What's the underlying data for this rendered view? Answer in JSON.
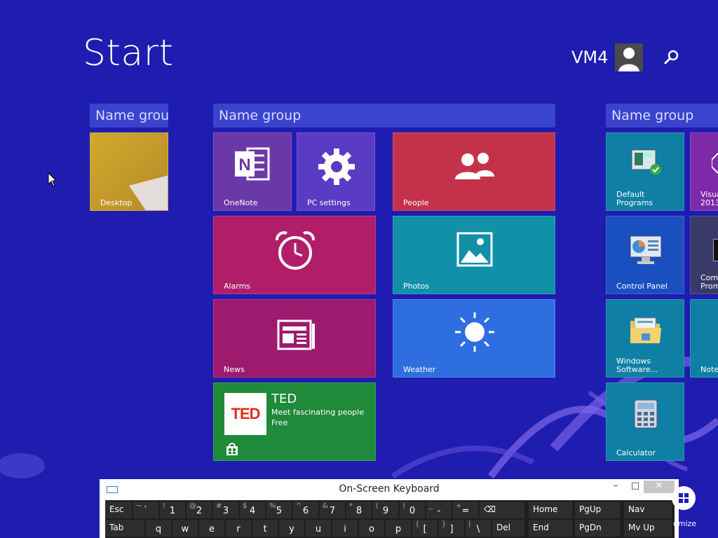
{
  "page": {
    "title": "Start",
    "bg_color": "#1f1cb0"
  },
  "user": {
    "name": "VM4"
  },
  "groups": [
    {
      "label": "Name grou"
    },
    {
      "label": "Name group"
    },
    {
      "label": "Name group"
    }
  ],
  "tiles": {
    "desktop": {
      "label": "Desktop",
      "color": "#c8a431"
    },
    "onenote": {
      "label": "OneNote",
      "color": "#6b38a8",
      "icon": "onenote-icon"
    },
    "pc_settings": {
      "label": "PC settings",
      "color": "#5a3bc4",
      "icon": "gear-icon"
    },
    "people": {
      "label": "People",
      "color": "#c4324a",
      "icon": "people-icon"
    },
    "alarms": {
      "label": "Alarms",
      "color": "#b01e6a",
      "icon": "alarm-clock-icon"
    },
    "photos": {
      "label": "Photos",
      "color": "#1290a8",
      "icon": "photos-icon"
    },
    "news": {
      "label": "News",
      "color": "#9e1a6e",
      "icon": "news-icon"
    },
    "weather": {
      "label": "Weather",
      "color": "#2f6ee0",
      "icon": "sun-icon"
    },
    "ted": {
      "title": "TED",
      "subtitle": "Meet fascinating people",
      "price": "Free",
      "logo": "TED",
      "color": "#1e8a3a",
      "icon": "store-icon"
    },
    "default_programs": {
      "label": "Default\nPrograms",
      "color": "#0f7fa5",
      "icon": "default-programs-icon"
    },
    "control_panel": {
      "label": "Control Panel",
      "color": "#1a4fc0",
      "icon": "control-panel-icon"
    },
    "windows_software": {
      "label": "Windows\nSoftware...",
      "color": "#0f7fa5",
      "icon": "folder-icon"
    },
    "calculator": {
      "label": "Calculator",
      "color": "#0f7fa5",
      "icon": "calculator-icon"
    },
    "visual_studio": {
      "label": "Visua\n2013",
      "color": "#7d2aa8"
    },
    "command_prompt": {
      "label": "Comm\nPromp",
      "color": "#3a3a6a"
    },
    "notepad": {
      "label": "Notep",
      "color": "#0f7fa5"
    }
  },
  "osk": {
    "title": "On-Screen Keyboard",
    "minimize": "–",
    "maximize": "□",
    "close": "✕",
    "row1": [
      {
        "main": "Esc"
      },
      {
        "main": "`",
        "shift": "~"
      },
      {
        "main": "1",
        "shift": "!"
      },
      {
        "main": "2",
        "shift": "@"
      },
      {
        "main": "3",
        "shift": "#"
      },
      {
        "main": "4",
        "shift": "$"
      },
      {
        "main": "5",
        "shift": "%"
      },
      {
        "main": "6",
        "shift": "^"
      },
      {
        "main": "7",
        "shift": "&"
      },
      {
        "main": "8",
        "shift": "*"
      },
      {
        "main": "9",
        "shift": "("
      },
      {
        "main": "0",
        "shift": ")"
      },
      {
        "main": "-",
        "shift": "_"
      },
      {
        "main": "=",
        "shift": "+"
      },
      {
        "main": "⌫"
      },
      {
        "main": "Home"
      },
      {
        "main": "PgUp"
      },
      {
        "main": "Nav"
      }
    ],
    "row2": [
      {
        "main": "Tab"
      },
      {
        "main": "q"
      },
      {
        "main": "w"
      },
      {
        "main": "e"
      },
      {
        "main": "r"
      },
      {
        "main": "t"
      },
      {
        "main": "y"
      },
      {
        "main": "u"
      },
      {
        "main": "i"
      },
      {
        "main": "o"
      },
      {
        "main": "p"
      },
      {
        "main": "[",
        "shift": "{"
      },
      {
        "main": "]",
        "shift": "}"
      },
      {
        "main": "\\",
        "shift": "|"
      },
      {
        "main": "Del"
      },
      {
        "main": "End"
      },
      {
        "main": "PgDn"
      },
      {
        "main": "Mv Up"
      }
    ]
  },
  "customize": {
    "label": "omize"
  }
}
